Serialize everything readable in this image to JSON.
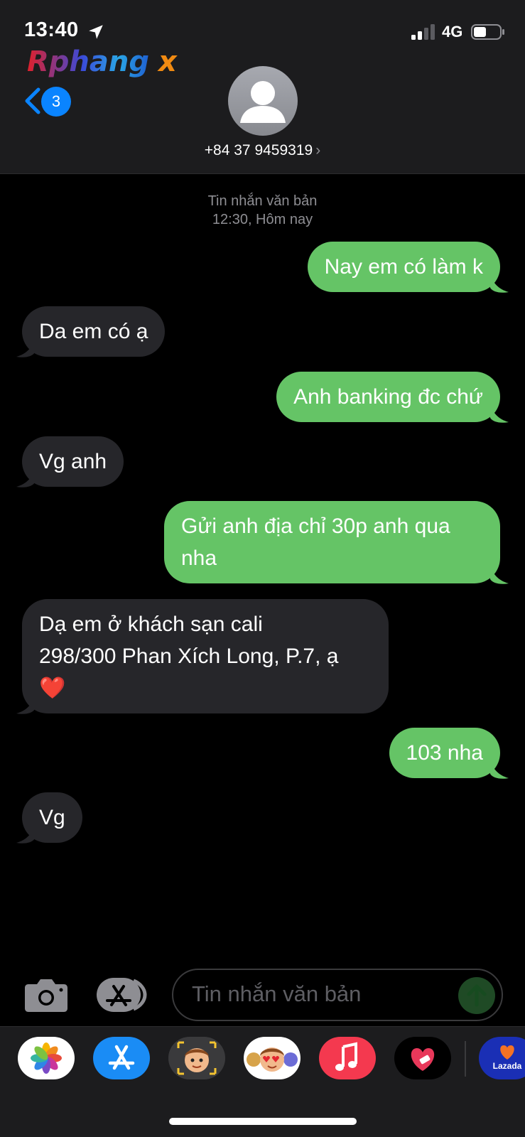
{
  "status_bar": {
    "time": "13:40",
    "network": "4G"
  },
  "watermark": {
    "text": "Rphangx"
  },
  "nav": {
    "back_count": "3",
    "contact": "+84 37 9459319",
    "chevron": "›"
  },
  "thread": {
    "type_label": "Tin nhắn văn bản",
    "time_label": "12:30, Hôm nay"
  },
  "messages": [
    {
      "direction": "out",
      "lines": [
        "Nay em có làm k"
      ]
    },
    {
      "direction": "in",
      "lines": [
        "Da em có ạ"
      ]
    },
    {
      "direction": "out",
      "lines": [
        "Anh banking đc chứ"
      ]
    },
    {
      "direction": "in",
      "lines": [
        "Vg anh"
      ]
    },
    {
      "direction": "out",
      "lines": [
        "Gửi anh địa chỉ 30p anh qua",
        "nha"
      ]
    },
    {
      "direction": "in",
      "lines": [
        "Dạ em ở khách sạn cali",
        "298/300 Phan Xích Long, P.7, ạ",
        "❤️"
      ]
    },
    {
      "direction": "out",
      "lines": [
        "103 nha"
      ]
    },
    {
      "direction": "in",
      "lines": [
        "Vg"
      ]
    }
  ],
  "composer": {
    "placeholder": "Tin nhắn văn bản"
  },
  "apps": [
    {
      "name": "photos-app-icon",
      "bg": "#ffffff"
    },
    {
      "name": "app-store-app-icon",
      "bg": "#1a8cf5"
    },
    {
      "name": "memoji-app-icon",
      "bg": "#2c2c2e"
    },
    {
      "name": "memoji-stickers-app-icon",
      "bg": "#ffffff"
    },
    {
      "name": "music-app-icon",
      "bg": "#f4394f"
    },
    {
      "name": "heart-app-icon",
      "bg": "#000000"
    },
    {
      "name": "lazada-app-icon",
      "bg": "#1a2fb5",
      "label": "Lazada"
    }
  ],
  "colors": {
    "outgoing": "#65c466",
    "incoming": "#26262a",
    "accent": "#0a84ff"
  }
}
